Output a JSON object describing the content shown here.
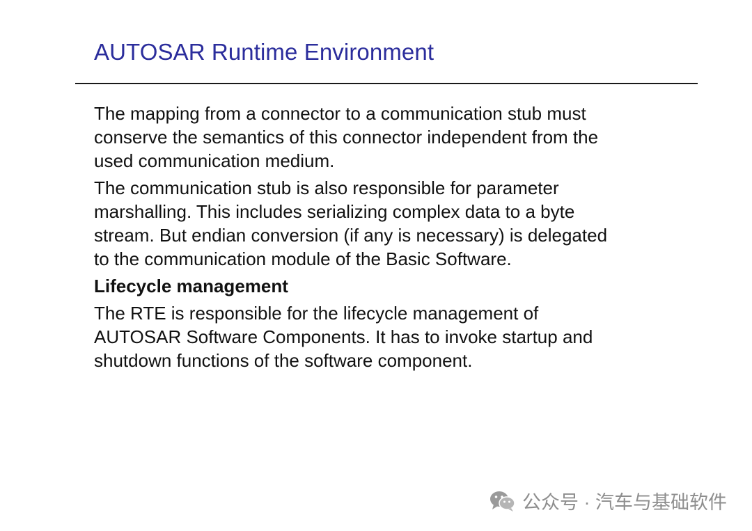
{
  "slide": {
    "title": "AUTOSAR Runtime Environment",
    "paragraphs": [
      {
        "lines": [
          "The mapping from a connector to a communication stub must",
          "conserve the semantics of this connector independent from the",
          "used communication medium."
        ]
      },
      {
        "lines": [
          "The communication stub is also responsible for parameter",
          "marshalling. This includes serializing complex data to a byte",
          "stream. But endian conversion (if any is necessary) is delegated",
          "to the communication module of the Basic Software."
        ]
      }
    ],
    "section_heading": "Lifecycle management",
    "section_paragraph": {
      "lines": [
        "The RTE is responsible for the lifecycle management of",
        "AUTOSAR Software Components. It has to invoke startup and",
        "shutdown functions of the software component."
      ]
    }
  },
  "watermark": {
    "icon": "wechat-icon",
    "text": "公众号 · 汽车与基础软件"
  }
}
